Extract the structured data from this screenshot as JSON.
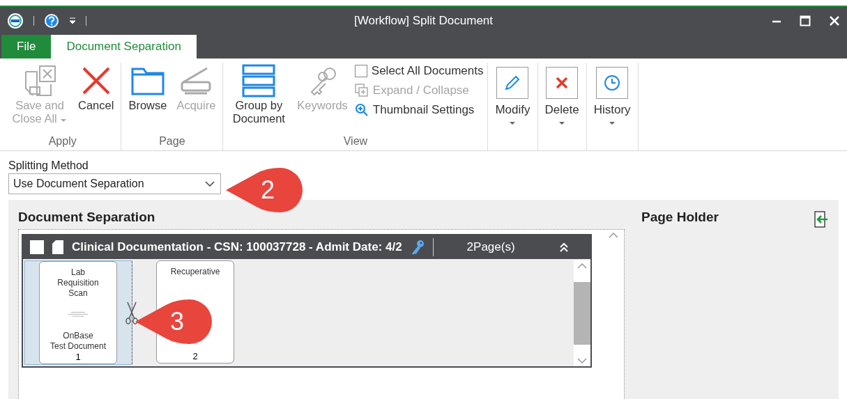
{
  "window": {
    "title": "[Workflow] Split Document"
  },
  "tabs": [
    {
      "label": "File",
      "selected": false
    },
    {
      "label": "Document Separation",
      "selected": true
    }
  ],
  "ribbon": {
    "groups": [
      {
        "label": "Apply",
        "items": [
          {
            "kind": "large",
            "label": "Save and Close All",
            "disabled": true,
            "dropdown": true
          },
          {
            "kind": "large",
            "label": "Cancel",
            "disabled": false,
            "dropdown": false
          }
        ]
      },
      {
        "label": "Page",
        "items": [
          {
            "kind": "large",
            "label": "Browse",
            "disabled": false,
            "dropdown": false
          },
          {
            "kind": "large",
            "label": "Acquire",
            "disabled": true,
            "dropdown": false
          }
        ]
      },
      {
        "label": "View",
        "items": [
          {
            "kind": "large",
            "label": "Group by Document",
            "disabled": false,
            "dropdown": false
          },
          {
            "kind": "large",
            "label": "Keywords",
            "disabled": true,
            "dropdown": false
          },
          {
            "kind": "check",
            "label": "Select All Documents",
            "checked": false,
            "disabled": false
          },
          {
            "kind": "small",
            "label": "Expand / Collapse",
            "disabled": true
          },
          {
            "kind": "small",
            "label": "Thumbnail Settings",
            "disabled": false
          }
        ]
      },
      {
        "items": [
          {
            "kind": "framed",
            "label": "Modify",
            "disabled": false,
            "dropdown": true
          }
        ]
      },
      {
        "items": [
          {
            "kind": "framed",
            "label": "Delete",
            "disabled": false,
            "dropdown": true
          }
        ]
      },
      {
        "items": [
          {
            "kind": "framed",
            "label": "History",
            "disabled": false,
            "dropdown": true
          }
        ]
      }
    ]
  },
  "splitting_method": {
    "label": "Splitting Method",
    "value": "Use Document Separation"
  },
  "callouts": [
    "2",
    "3"
  ],
  "document_separation": {
    "title": "Document Separation",
    "document": {
      "checked": false,
      "title": "Clinical Documentation - CSN: 100037728 - Admit Date: 4/2",
      "pages": "2Page(s)",
      "expanded": true,
      "thumbnails": [
        {
          "selected": true,
          "lines": [
            "Lab",
            "Requisition",
            "Scan"
          ],
          "footer": [
            "OnBase",
            "Test Document"
          ],
          "number": "1",
          "split_after": true
        },
        {
          "selected": false,
          "lines": [
            "Recuperative"
          ],
          "number": "2",
          "split_after": false
        }
      ]
    }
  },
  "page_holder": {
    "title": "Page Holder"
  }
}
